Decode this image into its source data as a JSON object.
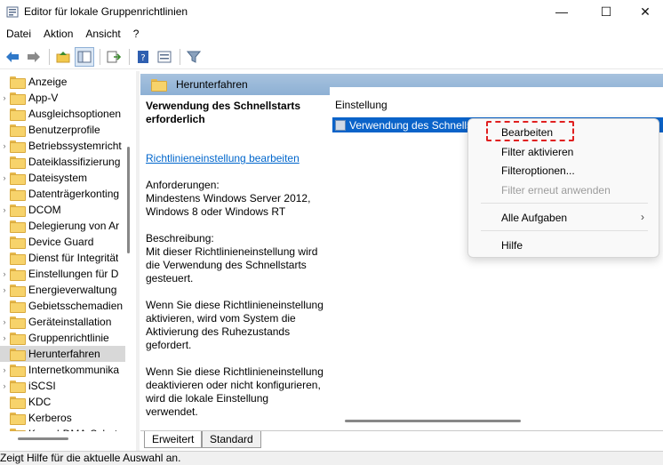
{
  "window": {
    "title": "Editor für lokale Gruppenrichtlinien",
    "minimize": "—",
    "maximize": "☐",
    "close": "✕"
  },
  "menu": [
    "Datei",
    "Aktion",
    "Ansicht",
    "?"
  ],
  "tree": {
    "items": [
      {
        "label": "Anzeige",
        "expandable": false
      },
      {
        "label": "App-V",
        "expandable": true
      },
      {
        "label": "Ausgleichsoptionen",
        "expandable": false
      },
      {
        "label": "Benutzerprofile",
        "expandable": false
      },
      {
        "label": "Betriebssystemricht",
        "expandable": true
      },
      {
        "label": "Dateiklassifizierung",
        "expandable": false
      },
      {
        "label": "Dateisystem",
        "expandable": true
      },
      {
        "label": "Datenträgerkonting",
        "expandable": false
      },
      {
        "label": "DCOM",
        "expandable": true
      },
      {
        "label": "Delegierung von Ar",
        "expandable": false
      },
      {
        "label": "Device Guard",
        "expandable": false
      },
      {
        "label": "Dienst für Integrität",
        "expandable": false
      },
      {
        "label": "Einstellungen für D",
        "expandable": true
      },
      {
        "label": "Energieverwaltung",
        "expandable": true
      },
      {
        "label": "Gebietsschemadien",
        "expandable": false
      },
      {
        "label": "Geräteinstallation",
        "expandable": true
      },
      {
        "label": "Gruppenrichtlinie",
        "expandable": true
      },
      {
        "label": "Herunterfahren",
        "expandable": false,
        "selected": true
      },
      {
        "label": "Internetkommunika",
        "expandable": true
      },
      {
        "label": "iSCSI",
        "expandable": true
      },
      {
        "label": "KDC",
        "expandable": false
      },
      {
        "label": "Kerberos",
        "expandable": false
      },
      {
        "label": "Kernel-DMA-Schut",
        "expandable": false
      }
    ]
  },
  "pane": {
    "header": "Herunterfahren"
  },
  "description": {
    "title": "Verwendung des Schnellstarts erforderlich",
    "link": "Richtlinieneinstellung bearbeiten",
    "requirements_label": "Anforderungen:",
    "requirements_text": "Mindestens Windows Server 2012, Windows 8 oder Windows RT",
    "description_label": "Beschreibung:",
    "description_text": "Mit dieser Richtlinieneinstellung wird die Verwendung des Schnellstarts gesteuert.",
    "enabled_text": "Wenn Sie diese Richtlinieneinstellung aktivieren, wird vom System die Aktivierung des Ruhezustands gefordert.",
    "disabled_text": "Wenn Sie diese Richtlinieneinstellung deaktivieren oder nicht konfigurieren, wird die lokale Einstellung verwendet."
  },
  "list": {
    "column": "Einstellung",
    "selected_row": "Verwendung des Schnellstarts erforderlich"
  },
  "context_menu": {
    "edit": "Bearbeiten",
    "filter_on": "Filter aktivieren",
    "filter_options": "Filteroptionen...",
    "filter_reapply": "Filter erneut anwenden",
    "all_tasks": "Alle Aufgaben",
    "all_tasks_arrow": "›",
    "help": "Hilfe"
  },
  "tabs": {
    "extended": "Erweitert",
    "standard": "Standard"
  },
  "status": "Zeigt Hilfe für die aktuelle Auswahl an.",
  "colors": {
    "selection": "#0a63c9",
    "header": "#8db0d4",
    "highlight": "#e02020"
  }
}
